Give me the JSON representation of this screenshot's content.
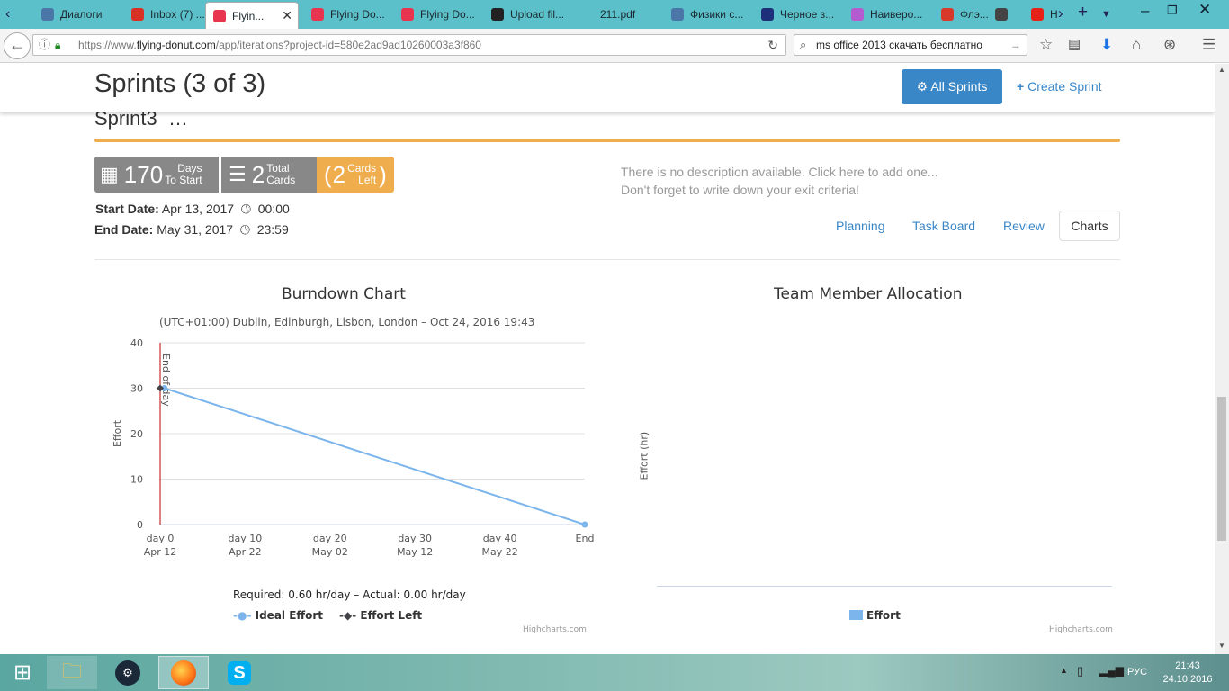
{
  "browser": {
    "tabs": [
      {
        "label": "Диалоги",
        "color": "#4a76a8"
      },
      {
        "label": "Inbox (7) ...",
        "color": "#d93025"
      },
      {
        "label": "Flyin...",
        "color": "#e8344e"
      },
      {
        "label": "Flying Do...",
        "color": "#e8344e"
      },
      {
        "label": "Flying Do...",
        "color": "#e8344e"
      },
      {
        "label": "Upload fil...",
        "color": "#222222"
      },
      {
        "label": "211.pdf",
        "color": "#5bc0ca"
      },
      {
        "label": "Физики с...",
        "color": "#4a76a8"
      },
      {
        "label": "Черное з...",
        "color": "#1d2f7a"
      },
      {
        "label": "Наиверо...",
        "color": "#b45bd0"
      },
      {
        "label": "Флэ...",
        "color": "#d83a2a"
      },
      {
        "label": "",
        "color": "#444444"
      },
      {
        "label": "Н",
        "color": "#e62117"
      }
    ],
    "url_prefix": "https://www.",
    "url_domain": "flying-donut.com",
    "url_rest": "/app/iterations?project-id=580e2ad9ad10260003a3f860",
    "search_text": "ms office 2013 скачать бесплатно"
  },
  "page": {
    "title": "Sprints (3 of 3)",
    "all_sprints": "All Sprints",
    "create_sprint": "Create Sprint",
    "sprint_name": "Sprint3",
    "sprint_more": "…",
    "days_count": "170",
    "days_label1": "Days",
    "days_label2": "To Start",
    "cards_count": "2",
    "cards_label1": "Total",
    "cards_label2": "Cards",
    "left_count": "2",
    "left_label1": "Cards",
    "left_label2": "Left",
    "start_label": "Start Date:",
    "start_date": "Apr 13, 2017",
    "start_time": "00:00",
    "end_label": "End Date:",
    "end_date": "May 31, 2017",
    "end_time": "23:59",
    "desc1": "There is no description available. Click here to add one...",
    "desc2": "Don't forget to write down your exit criteria!",
    "tabs": [
      "Planning",
      "Task Board",
      "Review",
      "Charts"
    ],
    "accent": "#f0ad4e"
  },
  "chart_data": [
    {
      "type": "line",
      "title": "Burndown Chart",
      "subtitle": "(UTC+01:00) Dublin, Edinburgh, Lisbon, London – Oct 24, 2016 19:43",
      "ylabel": "Effort",
      "ylim": [
        0,
        40
      ],
      "yticks": [
        "0",
        "10",
        "20",
        "30",
        "40"
      ],
      "x_max": 50,
      "xticks": [
        {
          "x": 0,
          "l1": "day 0",
          "l2": "Apr 12"
        },
        {
          "x": 10,
          "l1": "day 10",
          "l2": "Apr 22"
        },
        {
          "x": 20,
          "l1": "day 20",
          "l2": "May 02"
        },
        {
          "x": 30,
          "l1": "day 30",
          "l2": "May 12"
        },
        {
          "x": 40,
          "l1": "day 40",
          "l2": "May 22"
        },
        {
          "x": 50,
          "l1": "End",
          "l2": ""
        }
      ],
      "series": [
        {
          "name": "Ideal Effort",
          "color": "#7cb5ec",
          "x": [
            0.5,
            50
          ],
          "values": [
            30,
            0
          ]
        },
        {
          "name": "Effort Left",
          "color": "#434348",
          "x": [
            0
          ],
          "values": [
            30
          ]
        }
      ],
      "plotline": {
        "label": "End of day",
        "x": 0,
        "color": "#c00000"
      },
      "caption": "Required: 0.60 hr/day – Actual: 0.00 hr/day",
      "credit": "Highcharts.com"
    },
    {
      "type": "bar",
      "title": "Team Member Allocation",
      "ylabel": "Effort (hr)",
      "series": [
        {
          "name": "Effort",
          "color": "#7cb5ec",
          "values": []
        }
      ],
      "credit": "Highcharts.com"
    }
  ],
  "taskbar": {
    "lang": "РУС",
    "time": "21:43",
    "date": "24.10.2016"
  }
}
